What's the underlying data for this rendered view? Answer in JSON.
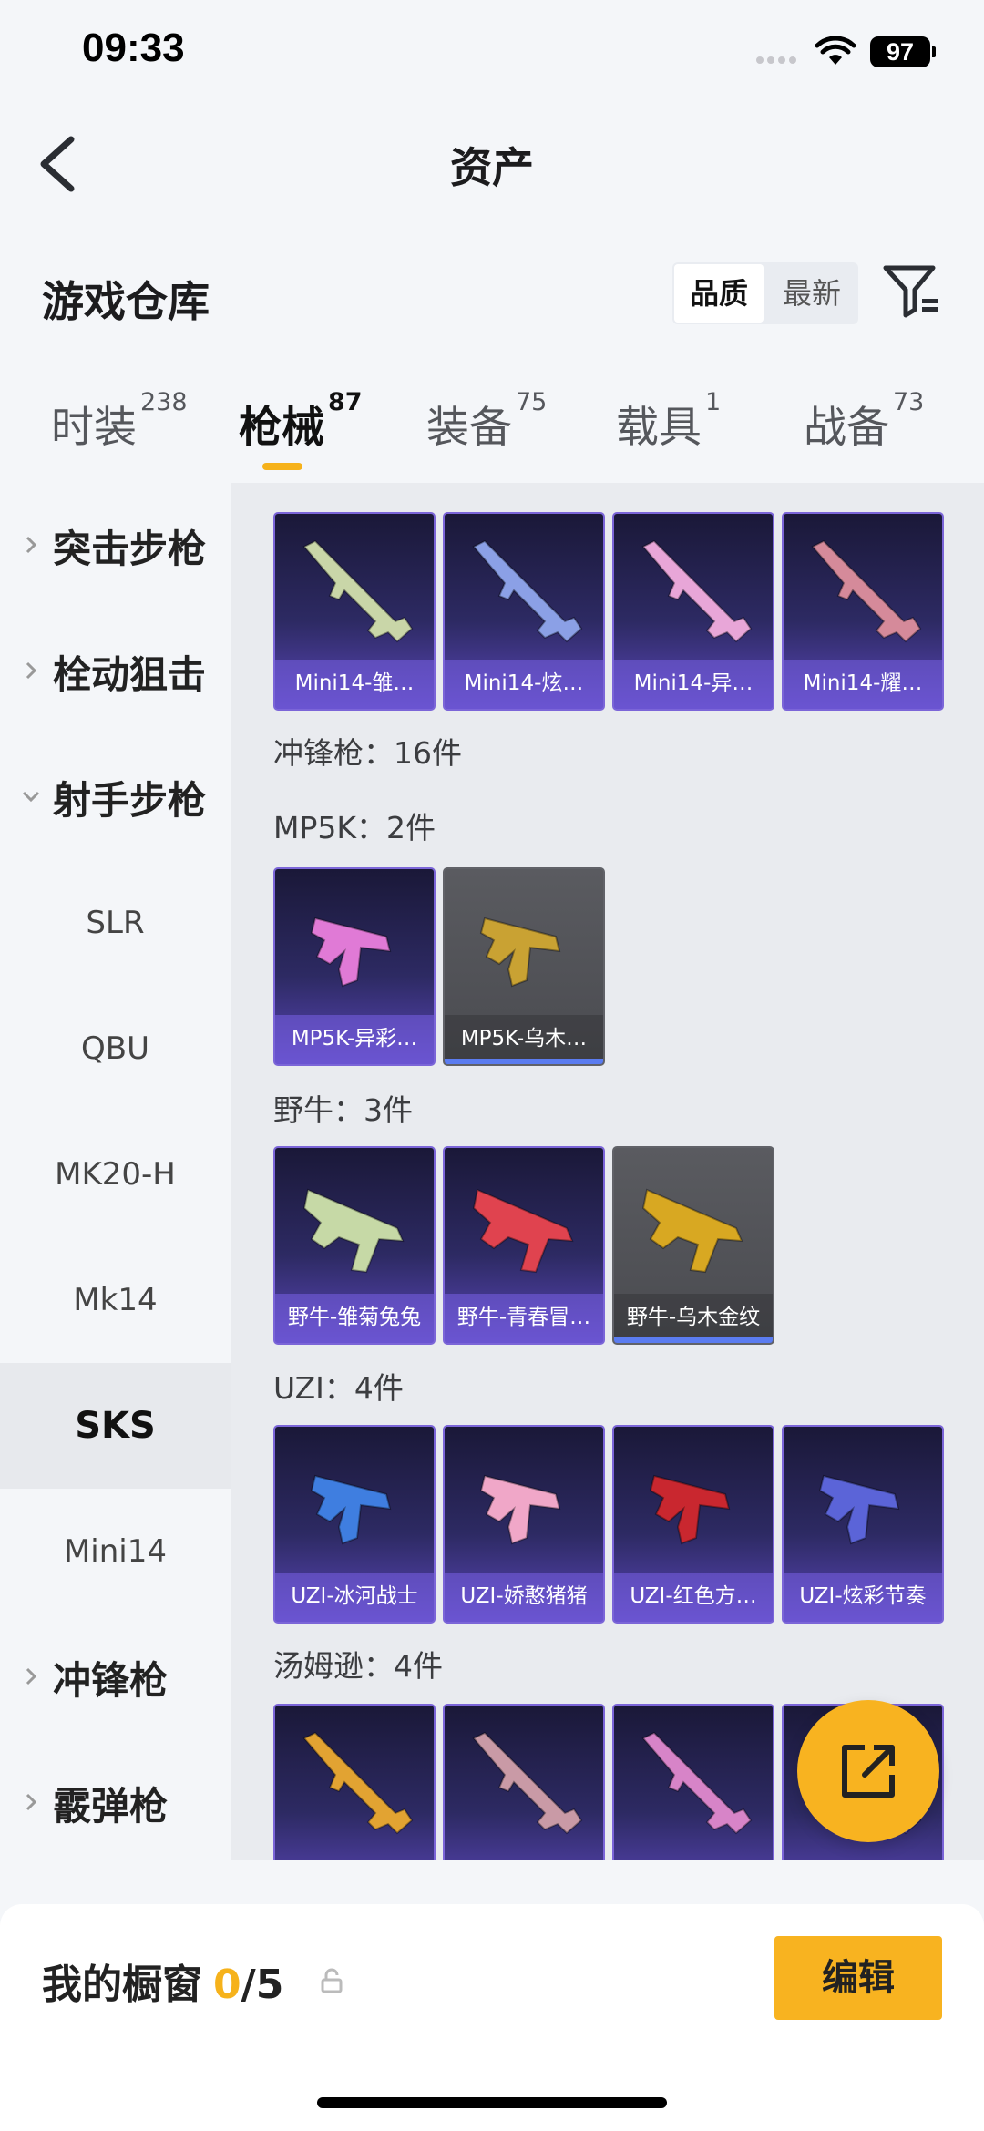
{
  "status": {
    "time": "09:33",
    "battery": "97"
  },
  "header": {
    "title": "资产"
  },
  "section": {
    "title": "游戏仓库",
    "sort_options": [
      "品质",
      "最新"
    ],
    "active_sort": "品质"
  },
  "tabs": [
    {
      "label": "时装",
      "count": "238"
    },
    {
      "label": "枪械",
      "count": "87",
      "active": true
    },
    {
      "label": "装备",
      "count": "75"
    },
    {
      "label": "载具",
      "count": "1"
    },
    {
      "label": "战备",
      "count": "73"
    }
  ],
  "sidebar": {
    "items": [
      {
        "label": "突击步枪",
        "type": "category",
        "expanded": false
      },
      {
        "label": "栓动狙击",
        "type": "category",
        "expanded": false
      },
      {
        "label": "射手步枪",
        "type": "category",
        "expanded": true
      },
      {
        "label": "SLR",
        "type": "sub"
      },
      {
        "label": "QBU",
        "type": "sub"
      },
      {
        "label": "MK20-H",
        "type": "sub"
      },
      {
        "label": "Mk14",
        "type": "sub"
      },
      {
        "label": "SKS",
        "type": "sub",
        "selected": true
      },
      {
        "label": "Mini14",
        "type": "sub"
      },
      {
        "label": "冲锋枪",
        "type": "category",
        "expanded": false
      },
      {
        "label": "霰弹枪",
        "type": "category",
        "expanded": false
      }
    ]
  },
  "content": {
    "mini14_cards": [
      {
        "name": "Mini14-雏…",
        "tier": "purple",
        "color": "#c9d6a8"
      },
      {
        "name": "Mini14-炫…",
        "tier": "purple",
        "color": "#8ba0e6"
      },
      {
        "name": "Mini14-异…",
        "tier": "purple",
        "color": "#e8a6d8"
      },
      {
        "name": "Mini14-耀…",
        "tier": "purple",
        "color": "#d58a9a"
      }
    ],
    "smg_total": "冲锋枪：16件",
    "groups": [
      {
        "label": "MP5K：2件",
        "cards": [
          {
            "name": "MP5K-异彩…",
            "tier": "purple",
            "color": "#e07ad6"
          },
          {
            "name": "MP5K-乌木…",
            "tier": "gray",
            "color": "#c9a233"
          }
        ]
      },
      {
        "label": "野牛：3件",
        "cards": [
          {
            "name": "野牛-雏菊兔兔",
            "tier": "purple",
            "color": "#c6d9a6"
          },
          {
            "name": "野牛-青春冒…",
            "tier": "purple",
            "color": "#e0434f"
          },
          {
            "name": "野牛-乌木金纹",
            "tier": "gray",
            "color": "#d8a822"
          }
        ]
      },
      {
        "label": "UZI：4件",
        "cards": [
          {
            "name": "UZI-冰河战士",
            "tier": "purple",
            "color": "#3f7ee0"
          },
          {
            "name": "UZI-娇憨猪猪",
            "tier": "purple",
            "color": "#f0a7c8"
          },
          {
            "name": "UZI-红色方…",
            "tier": "purple",
            "color": "#c9272f"
          },
          {
            "name": "UZI-炫彩节奏",
            "tier": "purple",
            "color": "#5b64d8"
          }
        ]
      },
      {
        "label": "汤姆逊：4件",
        "cards": [
          {
            "name": "",
            "tier": "purple",
            "color": "#e2a332"
          },
          {
            "name": "",
            "tier": "purple",
            "color": "#c99aa6"
          },
          {
            "name": "",
            "tier": "purple",
            "color": "#d784c8"
          },
          {
            "name": "",
            "tier": "purple",
            "color": "#8a7de0"
          }
        ]
      }
    ]
  },
  "showcase": {
    "title": "我的橱窗",
    "count": "0",
    "total": "/5",
    "edit_label": "编辑"
  }
}
